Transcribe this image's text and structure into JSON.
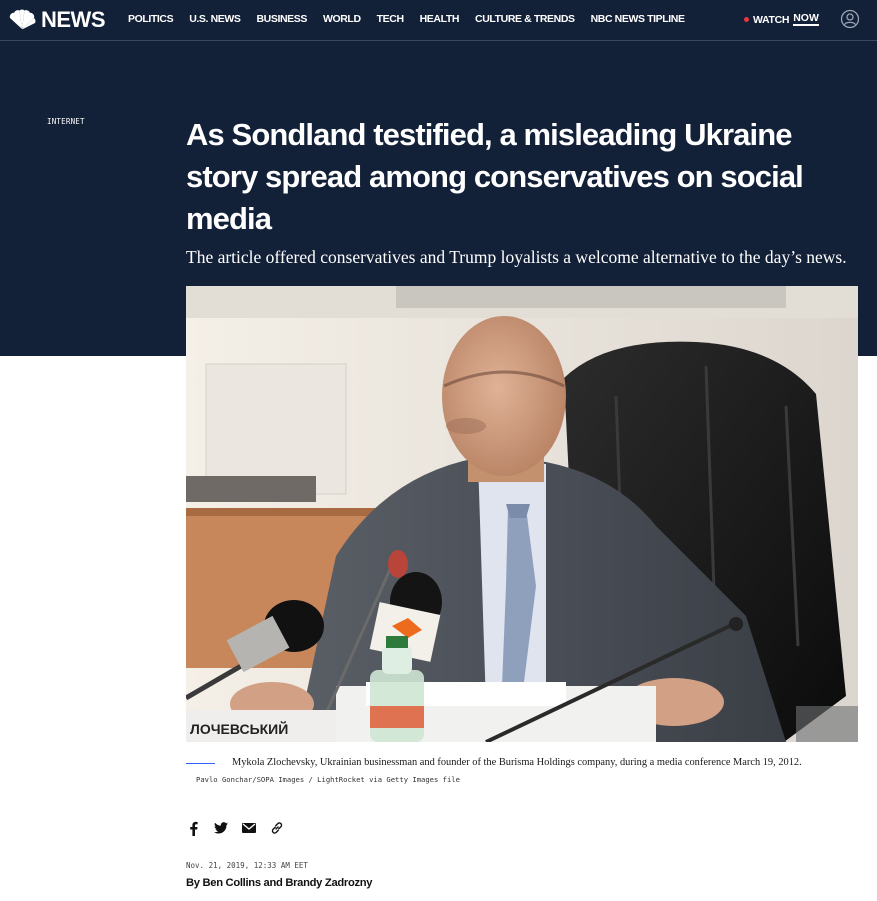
{
  "brand": {
    "name": "NEWS",
    "logo_icon": "nbc-peacock-icon"
  },
  "nav": {
    "links": [
      "POLITICS",
      "U.S. NEWS",
      "BUSINESS",
      "WORLD",
      "TECH",
      "HEALTH",
      "CULTURE & TRENDS",
      "NBC NEWS TIPLINE"
    ],
    "watch_label": "WATCH",
    "watch_now": "NOW",
    "account_icon": "user-account-icon"
  },
  "article": {
    "eyebrow": "INTERNET",
    "headline": "As Sondland testified, a misleading Ukraine story spread among conservatives on social media",
    "dek": "The article offered conservatives and Trump loyalists a welcome alternative to the day’s news.",
    "caption": "Mykola Zlochevsky, Ukrainian businessman and founder of the Burisma Holdings company, during a media conference March 19, 2012.",
    "credit": "Pavlo Gonchar/SOPA Images / LightRocket via Getty Images file",
    "nameplate_text": "ЛОЧЕВСЬКИЙ",
    "share_icons": [
      "facebook-icon",
      "twitter-icon",
      "email-icon",
      "link-icon"
    ],
    "dateline": "Nov. 21, 2019, 12:33 AM EET",
    "byline": "By Ben Collins and Brandy Zadrozny"
  },
  "colors": {
    "hero_background": "#122038",
    "accent_blue": "#3061ff",
    "live_dot": "#e0393e"
  }
}
